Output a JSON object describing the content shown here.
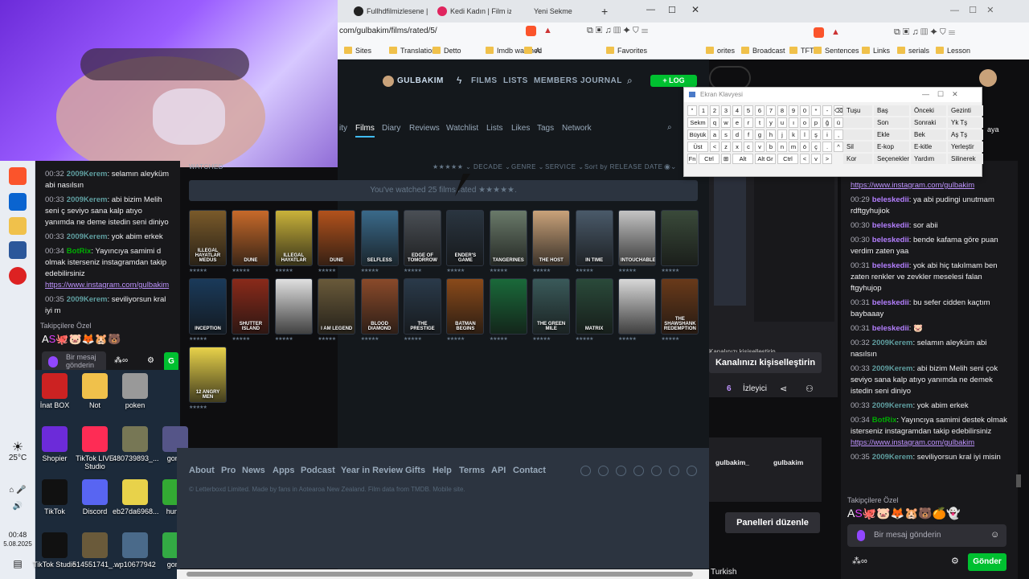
{
  "browser": {
    "tabs": [
      {
        "label": "Fullhdfilmizlesene |",
        "favicon": "#222"
      },
      {
        "label": "Kedi Kadın | Film izl",
        "favicon": "#e0245e"
      },
      {
        "label": "Yeni Sekme",
        "favicon": ""
      }
    ],
    "url": "com/gulbakim/films/rated/5/",
    "bookmarks": [
      "Sites",
      "Translation",
      "Detto",
      "Imdb watched",
      "Ai",
      "Favorites"
    ],
    "right_bookmarks": [
      "orites",
      "Broadcast",
      "TFT",
      "Sentences",
      "Links",
      "serials",
      "Lesson"
    ]
  },
  "letterboxd": {
    "username": "GULBAKIM",
    "nav": [
      "FILMS",
      "LISTS",
      "MEMBERS",
      "JOURNAL"
    ],
    "log_button": "+ LOG",
    "subnav": [
      "ity",
      "Films",
      "Diary",
      "Reviews",
      "Watchlist",
      "Lists",
      "Likes",
      "Tags",
      "Network"
    ],
    "subnav_active": "Films",
    "section_label": "WATCHED",
    "filters": [
      "★★★★★ ⌄",
      "DECADE ⌄",
      "GENRE ⌄",
      "SERVICE ⌄",
      "Sort by RELEASE DATE ⌄"
    ],
    "banner": "You've watched 25 films rated ★★★★★.",
    "posters": [
      {
        "title": "ILLEGAL HAYATLAR MEDUS",
        "bg": "#7a5a2a",
        "stars": "★★★★★"
      },
      {
        "title": "DUNE",
        "bg": "#c76a2a",
        "stars": "★★★★★"
      },
      {
        "title": "ILLEGAL HAYATLAR",
        "bg": "#c9b23a",
        "stars": "★★★★★"
      },
      {
        "title": "DUNE",
        "bg": "#b2521c",
        "stars": "★★★★★"
      },
      {
        "title": "SELFLESS",
        "bg": "#3a6a8a",
        "stars": "★★★★★"
      },
      {
        "title": "EDGE OF TOMORROW",
        "bg": "#4a4f55",
        "stars": "★★★★★"
      },
      {
        "title": "ENDER'S GAME",
        "bg": "#2a3540",
        "stars": "★★★★★"
      },
      {
        "title": "TANGERINES",
        "bg": "#6a7a6a",
        "stars": "★★★★★"
      },
      {
        "title": "THE HOST",
        "bg": "#c9a27a",
        "stars": "★★★★★"
      },
      {
        "title": "IN TIME",
        "bg": "#4a5a6a",
        "stars": "★★★★★"
      },
      {
        "title": "INTOUCHABLES",
        "bg": "#c4c4c4",
        "stars": "★★★★★"
      },
      {
        "title": "",
        "bg": "#3a4a3a",
        "stars": "★★★★★"
      },
      {
        "title": "INCEPTION",
        "bg": "#1a3a5a",
        "stars": "★★★★★"
      },
      {
        "title": "SHUTTER ISLAND",
        "bg": "#8a2a1a",
        "stars": "★★★★★"
      },
      {
        "title": "",
        "bg": "#e0e0e0",
        "stars": "★★★★★"
      },
      {
        "title": "I AM LEGEND",
        "bg": "#6a5a3a",
        "stars": "★★★★★"
      },
      {
        "title": "BLOOD DIAMOND",
        "bg": "#8a4a2a",
        "stars": "★★★★★"
      },
      {
        "title": "THE PRESTIGE",
        "bg": "#2a3a4a",
        "stars": "★★★★★"
      },
      {
        "title": "BATMAN BEGINS",
        "bg": "#8a4a1a",
        "stars": "★★★★★"
      },
      {
        "title": "",
        "bg": "#1a6a3a",
        "stars": "★★★★★"
      },
      {
        "title": "THE GREEN MILE",
        "bg": "#3a5a5a",
        "stars": "★★★★★"
      },
      {
        "title": "MATRIX",
        "bg": "#2a4a3a",
        "stars": "★★★★★"
      },
      {
        "title": "",
        "bg": "#d8d8d8",
        "stars": "★★★★★"
      },
      {
        "title": "THE SHAWSHANK REDEMPTION",
        "bg": "#6a3a1a",
        "stars": "★★★★★"
      },
      {
        "title": "12 ANGRY MEN",
        "bg": "#e8d24a",
        "stars": "★★★★★"
      }
    ],
    "footer_links": [
      "About",
      "Pro",
      "News",
      "Apps",
      "Podcast",
      "Year in Review",
      "Gifts",
      "Help",
      "Terms",
      "API",
      "Contact"
    ],
    "footer_copy": "© Letterboxd Limited. Made by fans in Aotearoa New Zealand. Film data from TMDB. Mobile site."
  },
  "keyboard": {
    "title": "Ekran Klavyesi",
    "rows": [
      [
        "\"",
        "1",
        "2",
        "3",
        "4",
        "5",
        "6",
        "7",
        "8",
        "9",
        "0",
        "*",
        "-",
        "⌫"
      ],
      [
        "Sekm",
        "q",
        "w",
        "e",
        "r",
        "t",
        "y",
        "u",
        "ı",
        "o",
        "p",
        "ğ",
        "ü",
        "Giriş"
      ],
      [
        "Büyük",
        "a",
        "s",
        "d",
        "f",
        "g",
        "h",
        "j",
        "k",
        "l",
        "ş",
        "i",
        ","
      ],
      [
        "Üst",
        "<",
        "z",
        "x",
        "c",
        "v",
        "b",
        "n",
        "m",
        "ö",
        "ç",
        ".",
        "^",
        "Üst"
      ],
      [
        "Fn",
        "Ctrl",
        "⊞",
        "Alt",
        "Alt Gr",
        "Ctrl",
        "<",
        "v",
        ">"
      ]
    ],
    "side_keys": [
      [
        "Tuşu",
        "Baş",
        "Önceki",
        "Gezinti"
      ],
      [
        "",
        "Son",
        "Sonraki",
        "Yk Tş"
      ],
      [
        "",
        "Ekle",
        "Bek",
        "Aş Tş"
      ],
      [
        "Sil",
        "E-kop",
        "E-kitle",
        "Yerleştir"
      ],
      [
        "Kor",
        "Seçenekler",
        "Yardım",
        "Silinerek"
      ]
    ]
  },
  "chat_left": [
    {
      "time": "00:32",
      "user": "2009Kerem",
      "color": "#5f9ea0",
      "text": ": selamın aleyküm abi nasılsın"
    },
    {
      "time": "00:33",
      "user": "2009Kerem",
      "color": "#5f9ea0",
      "text": ": abi bizim Melih seni ç seviyo sana kalp atıyo yanımda ne deme istedin seni diniyo"
    },
    {
      "time": "00:33",
      "user": "2009Kerem",
      "color": "#5f9ea0",
      "text": ": yok abim erkek"
    },
    {
      "time": "00:34",
      "user": "BotRix",
      "color": "#00ad03",
      "text": ": Yayıncıya samimi d olmak isterseniz instagramdan takip edebilirsiniz",
      "link": "https://www.instagram.com/gulbakim"
    },
    {
      "time": "00:35",
      "user": "2009Kerem",
      "color": "#5f9ea0",
      "text": ": seviliyorsun kral iyi m"
    }
  ],
  "chat_right": [
    {
      "time": "",
      "user": "",
      "color": "",
      "text": "edebilirsiniz",
      "link": "https://www.instagram.com/gulbakim"
    },
    {
      "time": "00:29",
      "user": "beleskedii",
      "color": "#b47fff",
      "text": ": ya abi pudingi unutmam rdftgyhujiok"
    },
    {
      "time": "00:30",
      "user": "beleskedii",
      "color": "#b47fff",
      "text": ": sor abii"
    },
    {
      "time": "00:30",
      "user": "beleskedii",
      "color": "#b47fff",
      "text": ": bende kafama göre puan verdim zaten yaa"
    },
    {
      "time": "00:31",
      "user": "beleskedii",
      "color": "#b47fff",
      "text": ": yok abi hiç takılmam ben zaten renkler ve zevkler meselesi falan ftgyhujop"
    },
    {
      "time": "00:31",
      "user": "beleskedii",
      "color": "#b47fff",
      "text": ": bu sefer cidden kaçtım baybaaay"
    },
    {
      "time": "00:31",
      "user": "beleskedii",
      "color": "#b47fff",
      "text": ": 🐷"
    },
    {
      "time": "00:32",
      "user": "2009Kerem",
      "color": "#5f9ea0",
      "text": ": selamın aleyküm abi nasılsın"
    },
    {
      "time": "00:33",
      "user": "2009Kerem",
      "color": "#5f9ea0",
      "text": ": abi bizim Melih seni çok seviyo sana kalp atıyo yanımda ne demek istedin seni diniyo"
    },
    {
      "time": "00:33",
      "user": "2009Kerem",
      "color": "#5f9ea0",
      "text": ": yok abim erkek"
    },
    {
      "time": "00:34",
      "user": "BotRix",
      "color": "#00ad03",
      "text": ": Yayıncıya samimi destek olmak isterseniz instagramdan takip edebilirsiniz",
      "link": "https://www.instagram.com/gulbakim"
    },
    {
      "time": "00:35",
      "user": "2009Kerem",
      "color": "#5f9ea0",
      "text": ": seviliyorsun kral iyi misin"
    }
  ],
  "twitch": {
    "emote_label": "Takipçilere Özel",
    "input_placeholder": "Bir mesaj gönderin",
    "left_input": "Bir mesaj gönderin",
    "send": "Gönder",
    "customize": "Kanalınızı kişiselleştirin",
    "viewers": "6",
    "viewers_label": "İzleyici",
    "socials": [
      "gulbakim_",
      "gulbakim"
    ],
    "edit_panels": "Panelleri düzenle",
    "language": "Turkish",
    "topright_fragment": "aya"
  },
  "desktop_icons": [
    {
      "label": "İnat BOX",
      "color": "#c22"
    },
    {
      "label": "Not",
      "color": "#f0c14b"
    },
    {
      "label": "poken",
      "color": "#999"
    },
    {
      "label": "Shopier",
      "color": "#6c2bd9"
    },
    {
      "label": "TikTok LIVE Studio",
      "color": "#fe2c55"
    },
    {
      "label": "480739893_...",
      "color": "#775"
    },
    {
      "label": "gonfr",
      "color": "#558"
    },
    {
      "label": "TikTok",
      "color": "#111"
    },
    {
      "label": "Discord",
      "color": "#5865f2"
    },
    {
      "label": "eb27da6968...",
      "color": "#e8d24a"
    },
    {
      "label": "hunte",
      "color": "#3a3"
    },
    {
      "label": "TikTok Studio",
      "color": "#111"
    },
    {
      "label": "514551741_...",
      "color": "#6a5a3a"
    },
    {
      "label": "wp10677942",
      "color": "#4a6a8a"
    },
    {
      "label": "gon-f",
      "color": "#3a4"
    }
  ],
  "system": {
    "weather": "25°C",
    "time": "00:48",
    "date": "5.08.2025"
  }
}
